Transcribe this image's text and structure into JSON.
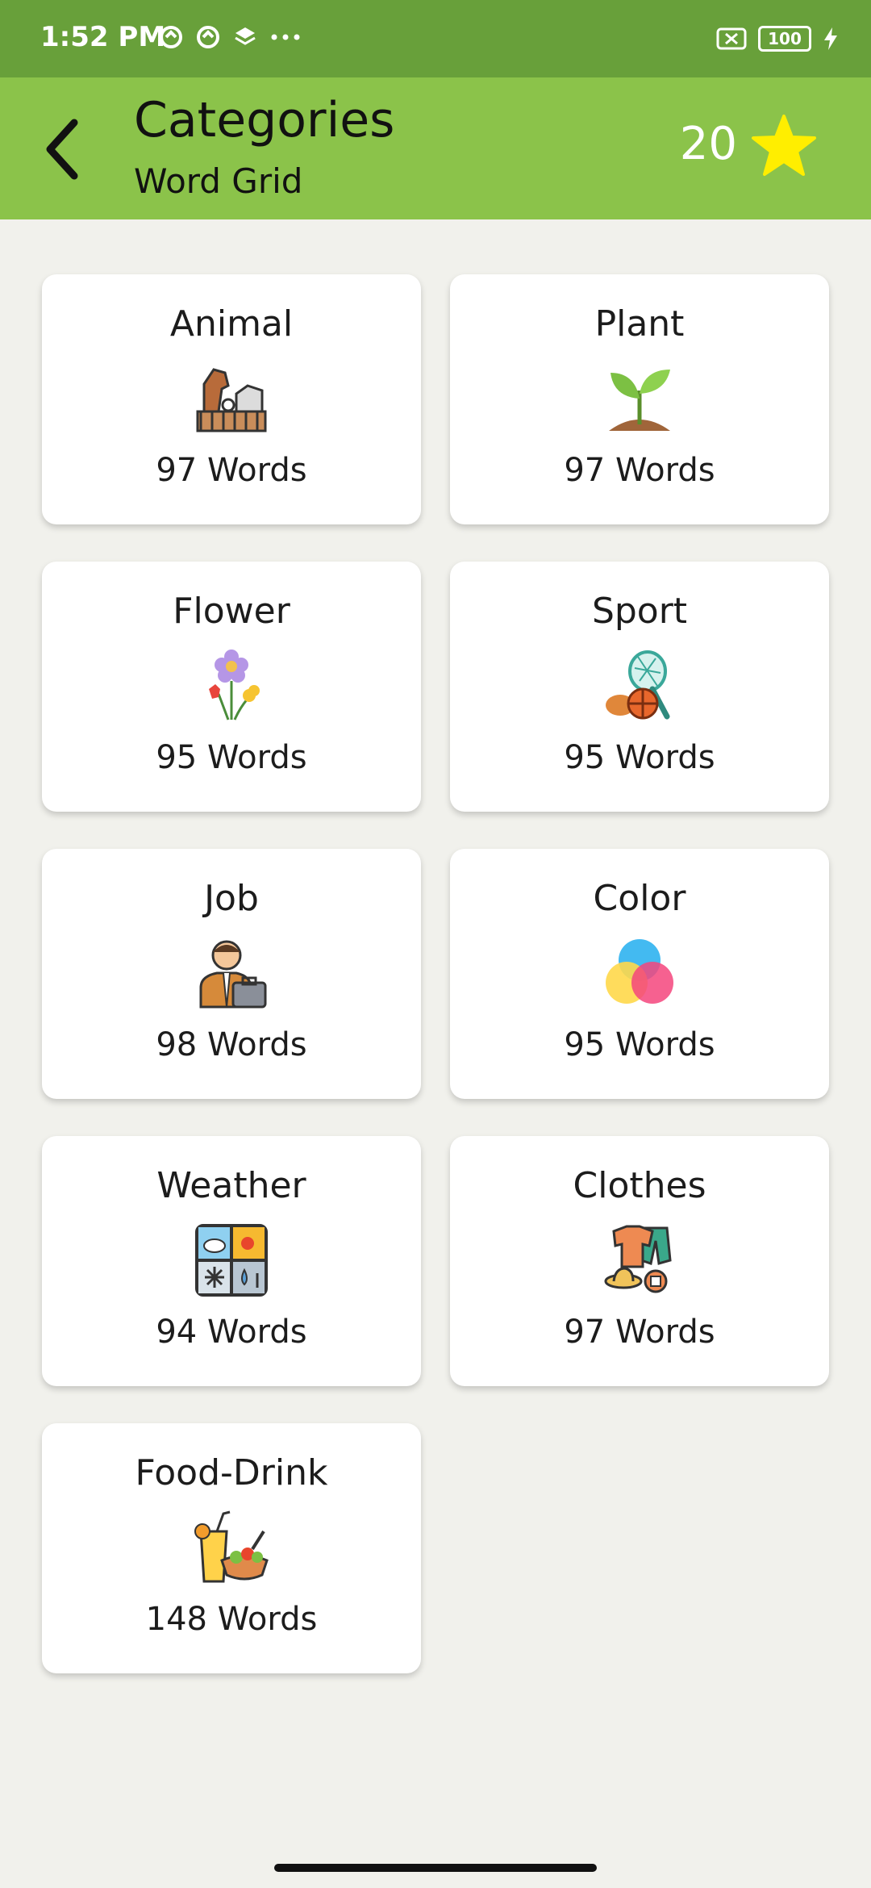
{
  "status_bar": {
    "time": "1:52 PM",
    "battery": "100"
  },
  "header": {
    "title": "Categories",
    "subtitle": "Word Grid",
    "score": "20"
  },
  "categories": [
    {
      "name": "Animal",
      "count": "97 Words",
      "icon": "animal-icon"
    },
    {
      "name": "Plant",
      "count": "97 Words",
      "icon": "plant-icon"
    },
    {
      "name": "Flower",
      "count": "95 Words",
      "icon": "flower-icon"
    },
    {
      "name": "Sport",
      "count": "95 Words",
      "icon": "sport-icon"
    },
    {
      "name": "Job",
      "count": "98 Words",
      "icon": "job-icon"
    },
    {
      "name": "Color",
      "count": "95 Words",
      "icon": "color-icon"
    },
    {
      "name": "Weather",
      "count": "94 Words",
      "icon": "weather-icon"
    },
    {
      "name": "Clothes",
      "count": "97 Words",
      "icon": "clothes-icon"
    },
    {
      "name": "Food-Drink",
      "count": "148 Words",
      "icon": "food-drink-icon"
    }
  ],
  "colors": {
    "status_bar": "#68a03a",
    "app_bar": "#8bc34a",
    "star": "#ffee00",
    "background": "#f1f1ec"
  }
}
